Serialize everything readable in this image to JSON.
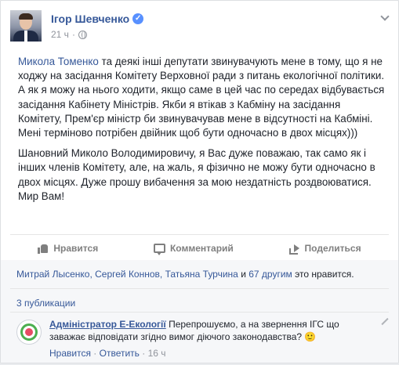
{
  "post": {
    "author": "Ігор Шевченко",
    "verified_mark": "✓",
    "time": "21 ч",
    "paragraph1_link": "Микола Томенко",
    "paragraph1_text": " та деякі інші депутати звинувачують мене в тому, що я не ходжу на засідання Комітету Верховної ради з питань екологічної політики. А як я можу на нього ходити, якщо саме в цей час по середах відбувається засідання Кабінету Міністрів. Якби я втікав з Кабміну на засідання Комітету, Прем'єр міністр би звинувачував мене в відсутності на Кабміні. Мені терміново потрібен двійник щоб бути одночасно в двох місцях)))",
    "paragraph2_text": "Шановний Миколо Володимировичу, я Вас дуже поважаю, так само як і інших членів Комітету, але, на жаль, я фізично не можу бути одночасно в двох місцях. Дуже прошу вибачення за мою нездатність роздвоюватися. Мир Вам!"
  },
  "actions": {
    "like": "Нравится",
    "comment": "Комментарий",
    "share": "Поделиться"
  },
  "likes": {
    "names": "Митрай Лысенко, Сергей Коннов, Татьяна Турчина",
    "and": " и ",
    "others": "67 другим",
    "suffix": " это нравится."
  },
  "shares": {
    "label": "3 публикации"
  },
  "comment": {
    "author": "Адміністратор Е-Екології",
    "text": " Перепрошуємо, а на звернення ІГС що заважає відповідати згідно вимог діючого законодавства? 🙂",
    "like_link": "Нравится",
    "sep": " · ",
    "reply_link": "Ответить",
    "time": "16 ч"
  }
}
